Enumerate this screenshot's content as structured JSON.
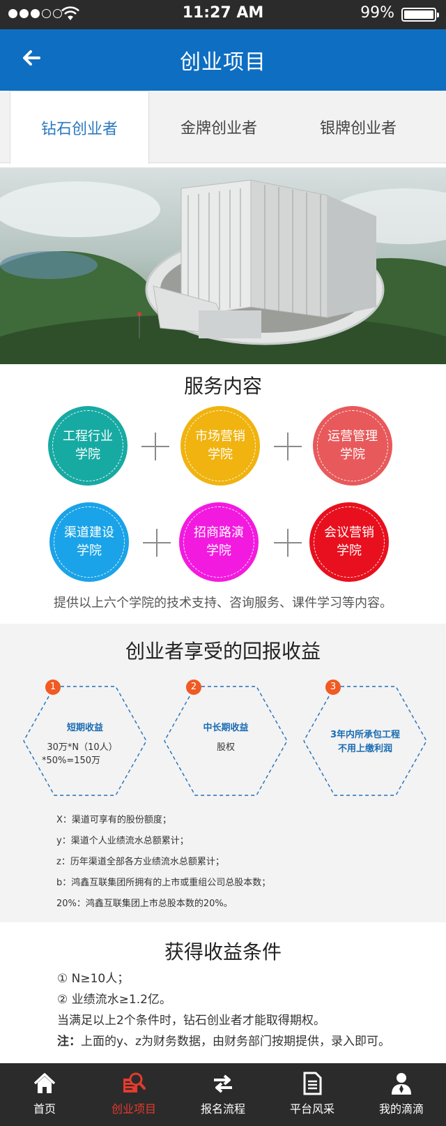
{
  "status_bar": {
    "time": "11:27 AM",
    "battery": "99%"
  },
  "header": {
    "title": "创业项目"
  },
  "tabs": [
    {
      "label": "钻石创业者"
    },
    {
      "label": "金牌创业者"
    },
    {
      "label": "银牌创业者"
    }
  ],
  "services": {
    "title": "服务内容",
    "items": [
      {
        "line1": "工程行业",
        "line2": "学院",
        "color": "#17aaa3"
      },
      {
        "line1": "市场营销",
        "line2": "学院",
        "color": "#f0b30f"
      },
      {
        "line1": "运营管理",
        "line2": "学院",
        "color": "#e8595b"
      },
      {
        "line1": "渠道建设",
        "line2": "学院",
        "color": "#1aa3e8"
      },
      {
        "line1": "招商路演",
        "line2": "学院",
        "color": "#f31ae0"
      },
      {
        "line1": "会议营销",
        "line2": "学院",
        "color": "#e8101e"
      }
    ],
    "description": "提供以上六个学院的技术支持、咨询服务、课件学习等内容。"
  },
  "benefits": {
    "title": "创业者享受的回报收益",
    "cards": [
      {
        "num": "1",
        "title": "短期收益",
        "line1": "30万*N（10人）",
        "line2": "*50%=150万"
      },
      {
        "num": "2",
        "title": "中长期收益",
        "line1": "股权",
        "line2": ""
      },
      {
        "num": "3",
        "title": "3年内所承包工程",
        "line1": "不用上缴利润",
        "line2": ""
      }
    ],
    "notes": [
      "X：渠道可享有的股份额度；",
      "y：渠道个人业绩流水总额累计；",
      "z：历年渠道全部各方业绩流水总额累计；",
      "b：鸿鑫互联集团所拥有的上市或重组公司总股本数；",
      "20%：鸿鑫互联集团上市总股本数的20%。"
    ]
  },
  "conditions": {
    "title": "获得收益条件",
    "items": [
      "① N≥10人；",
      "② 业绩流水≥1.2亿。",
      "当满足以上2个条件时，钻石创业者才能取得期权。"
    ],
    "note_label": "注：",
    "note_text": "上面的y、z为财务数据，由财务部门按期提供，录入即可。"
  },
  "bottom_nav": [
    {
      "label": "首页",
      "icon": "home-icon"
    },
    {
      "label": "创业项目",
      "icon": "project-search-icon"
    },
    {
      "label": "报名流程",
      "icon": "swap-arrows-icon"
    },
    {
      "label": "平台风采",
      "icon": "document-icon"
    },
    {
      "label": "我的滴滴",
      "icon": "user-icon"
    }
  ],
  "colors": {
    "header": "#0e6ec2",
    "tab_active": "#2a78c0",
    "nav_active": "#e53a2e",
    "hex_title": "#1a6cb4",
    "badge": "#f05a23"
  }
}
